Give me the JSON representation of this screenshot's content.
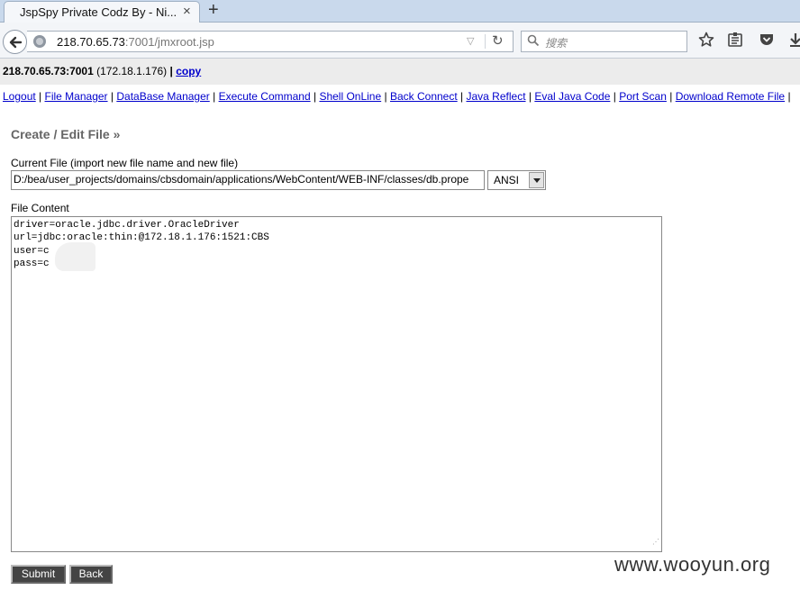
{
  "browser": {
    "tab_title": "JspSpy Private Codz By - Ni...",
    "tab_close": "×",
    "new_tab": "+",
    "url_host": "218.70.65.73",
    "url_rest": ":7001/jmxroot.jsp",
    "search_placeholder": "搜索",
    "icons": [
      "back-arrow-icon",
      "globe-icon",
      "dropdown-icon",
      "reload-icon",
      "search-icon",
      "bookmark-star-icon",
      "reading-list-icon",
      "pocket-icon",
      "download-icon"
    ]
  },
  "host": {
    "address": "218.70.65.73:7001",
    "internal": "(172.18.1.176)",
    "separator": "|",
    "copy_label": "copy"
  },
  "menu": [
    "Logout",
    "File Manager",
    "DataBase Manager",
    "Execute Command",
    "Shell OnLine",
    "Back Connect",
    "Java Reflect",
    "Eval Java Code",
    "Port Scan",
    "Download Remote File"
  ],
  "editor": {
    "title": "Create / Edit File »",
    "current_file_label": "Current File (import new file name and new file)",
    "file_path": "D:/bea/user_projects/domains/cbsdomain/applications/WebContent/WEB-INF/classes/db.prope",
    "charset": "ANSI",
    "content_label": "File Content",
    "content_lines": [
      "driver=oracle.jdbc.driver.OracleDriver",
      "url=jdbc:oracle:thin:@172.18.1.176:1521:CBS",
      "user=c",
      "pass=c"
    ],
    "submit_label": "Submit",
    "back_label": "Back"
  },
  "watermark": "www.wooyun.org"
}
